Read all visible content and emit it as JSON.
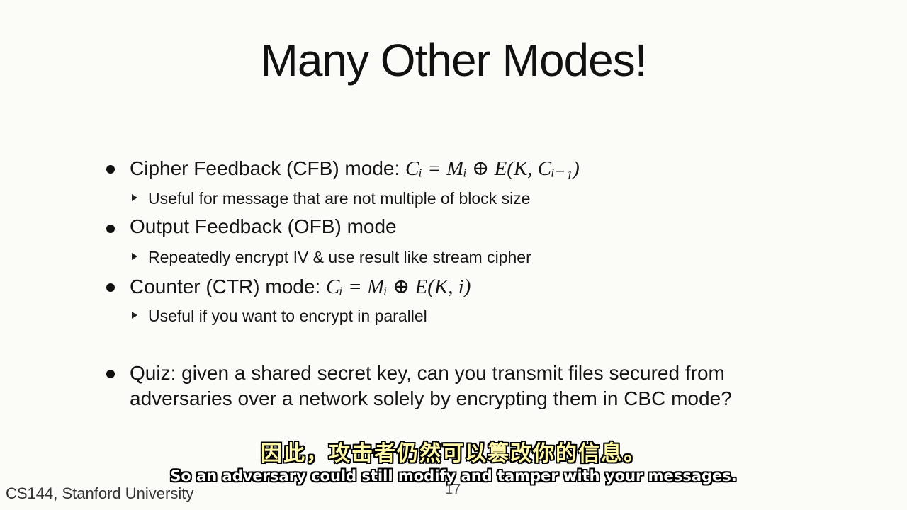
{
  "slide": {
    "title": "Many Other Modes!",
    "bullets": [
      {
        "text": "Cipher Feedback (CFB) mode:",
        "formula": "Cᵢ = Mᵢ ⊕ E(K, Cᵢ₋₁)",
        "sub": "Useful for message that are not multiple of block size"
      },
      {
        "text": "Output Feedback (OFB) mode",
        "formula": "",
        "sub": "Repeatedly encrypt IV & use result like stream cipher"
      },
      {
        "text": "Counter (CTR) mode:",
        "formula": "Cᵢ = Mᵢ ⊕ E(K, i)",
        "sub": "Useful if you want to encrypt in parallel"
      }
    ],
    "quiz": "Quiz: given a shared secret key, can you transmit files secured from adversaries over a network solely by encrypting them in CBC mode?",
    "footer": "CS144, Stanford University",
    "page_number": "17"
  },
  "subtitles": {
    "zh": "因此，攻击者仍然可以篡改你的信息。",
    "en": "So an adversary could still modify and tamper with your messages."
  }
}
